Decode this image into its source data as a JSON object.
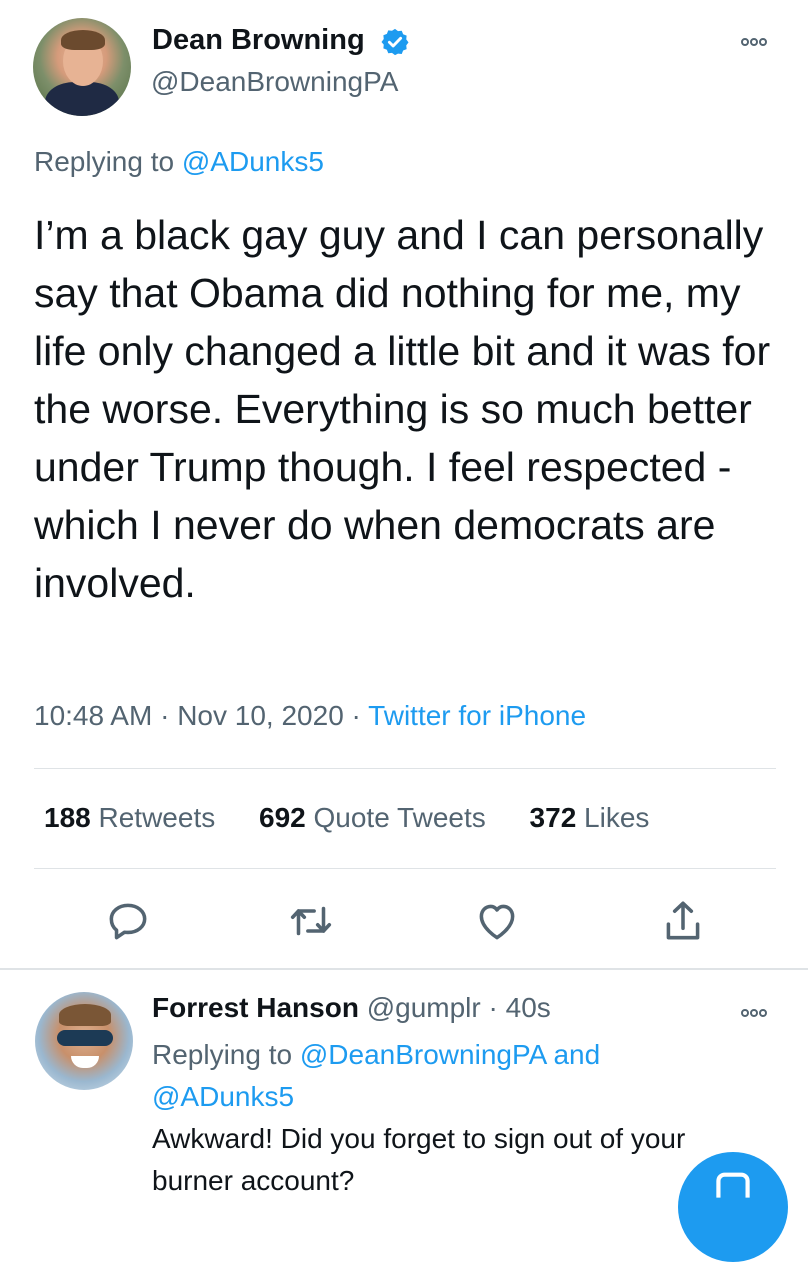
{
  "main_tweet": {
    "display_name": "Dean Browning",
    "handle": "@DeanBrowningPA",
    "replying_prefix": "Replying to ",
    "replying_handle": "@ADunks5",
    "text": "I’m a black gay guy and I can personally say that Obama did nothing for me, my life only changed a little bit and it was for the worse. Everything is so much better under Trump though. I feel respected - which I never do when democrats are involved.",
    "time": "10:48 AM",
    "date": "Nov 10, 2020",
    "source": "Twitter for iPhone",
    "separator": " · ",
    "stats": {
      "retweets_count": "188",
      "retweets_label": "Retweets",
      "quotes_count": "692",
      "quotes_label": "Quote Tweets",
      "likes_count": "372",
      "likes_label": "Likes"
    }
  },
  "reply_tweet": {
    "display_name": "Forrest Hanson",
    "handle": "@gumplr",
    "separator": " · ",
    "time_ago": "40s",
    "replying_prefix": "Replying to ",
    "replying_handle_1": "@DeanBrowningPA",
    "replying_and": " and ",
    "replying_handle_2": "@ADunks5",
    "text": "Awkward! Did you forget to sign out of your burner account?"
  },
  "icons": {
    "verified": "verified-badge-icon",
    "more": "more-options-icon",
    "reply": "reply-icon",
    "retweet": "retweet-icon",
    "like": "heart-icon",
    "share": "share-icon",
    "compose": "compose-icon"
  },
  "colors": {
    "accent": "#1d9bf0",
    "text_primary": "#0f1419",
    "text_secondary": "#536471",
    "divider": "#dfe3e6"
  }
}
